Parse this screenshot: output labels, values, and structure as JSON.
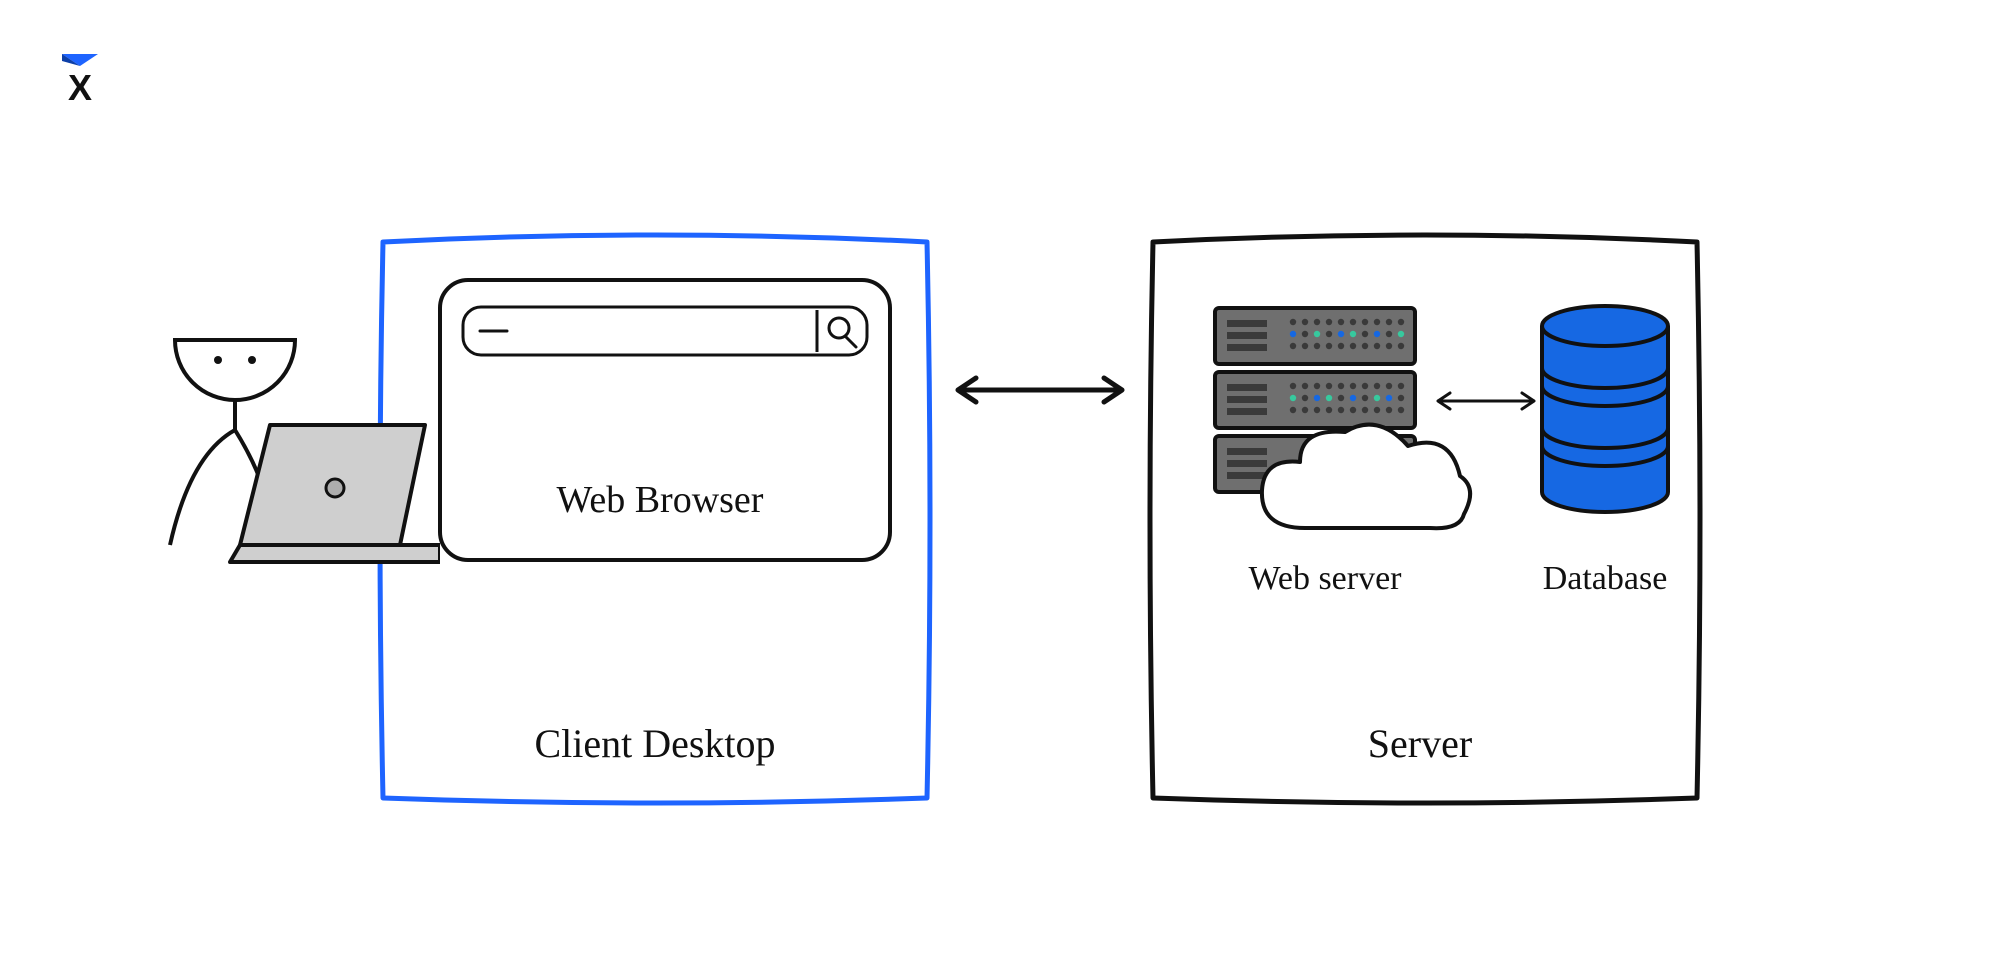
{
  "logo": {
    "letter": "X"
  },
  "client": {
    "box_label": "Client Desktop",
    "browser_label": "Web Browser"
  },
  "server": {
    "box_label": "Server",
    "webserver_label": "Web server",
    "database_label": "Database"
  },
  "colors": {
    "accent_blue": "#1e64ff",
    "database_blue": "#1668e3",
    "server_gray": "#6f6f6f",
    "server_dark": "#3a3a3a",
    "laptop_gray": "#c9c9c9",
    "black": "#111111"
  }
}
